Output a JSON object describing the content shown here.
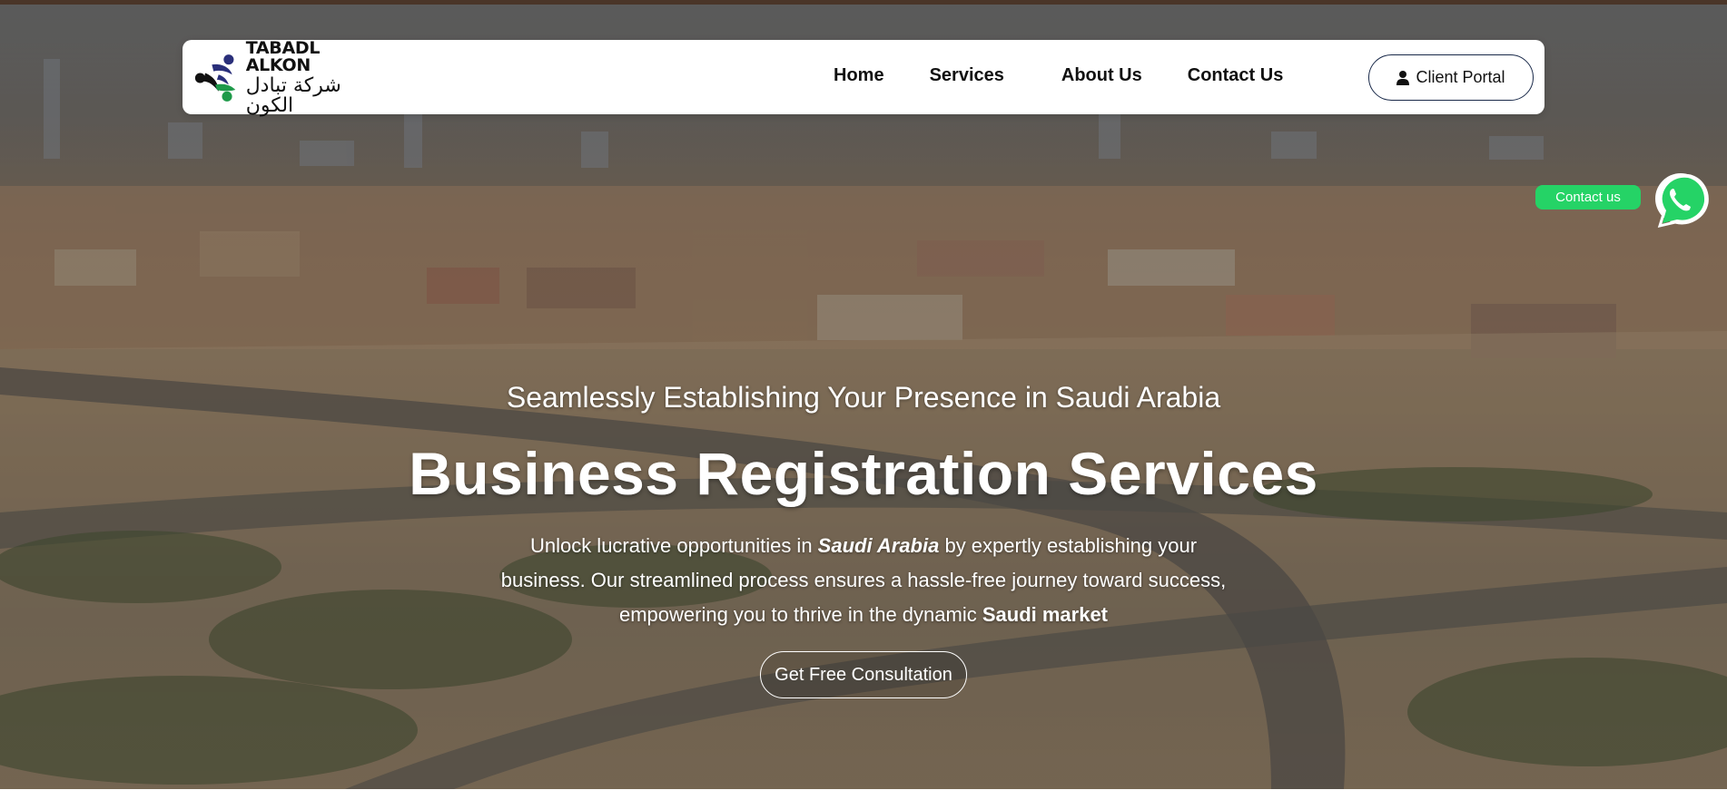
{
  "header": {
    "logo_name_en": "TABADL ALKON",
    "logo_name_ar": "شركة تبادل الكون",
    "nav": [
      {
        "label": "Home"
      },
      {
        "label": "Services"
      },
      {
        "label": "About Us"
      },
      {
        "label": "Contact Us"
      }
    ],
    "client_portal_label": "Client Portal",
    "client_portal_icon": "person-icon"
  },
  "whatsapp": {
    "label": "Contact us",
    "icon": "whatsapp-icon",
    "color": "#25d366"
  },
  "hero": {
    "subtitle": "Seamlessly Establishing Your Presence in Saudi Arabia",
    "title": "Business Registration Services",
    "desc_part1": "Unlock lucrative opportunities in ",
    "desc_em1": "Saudi Arabia",
    "desc_part2": " by expertly establishing your business. Our streamlined process ensures a hassle-free journey toward success, empowering you to thrive in the dynamic ",
    "desc_em2": "Saudi market",
    "cta_label": "Get Free Consultation"
  },
  "colors": {
    "top_strip": "#4a3528",
    "brand_navy": "#2a2f7a",
    "brand_green": "#1f9a4a"
  }
}
